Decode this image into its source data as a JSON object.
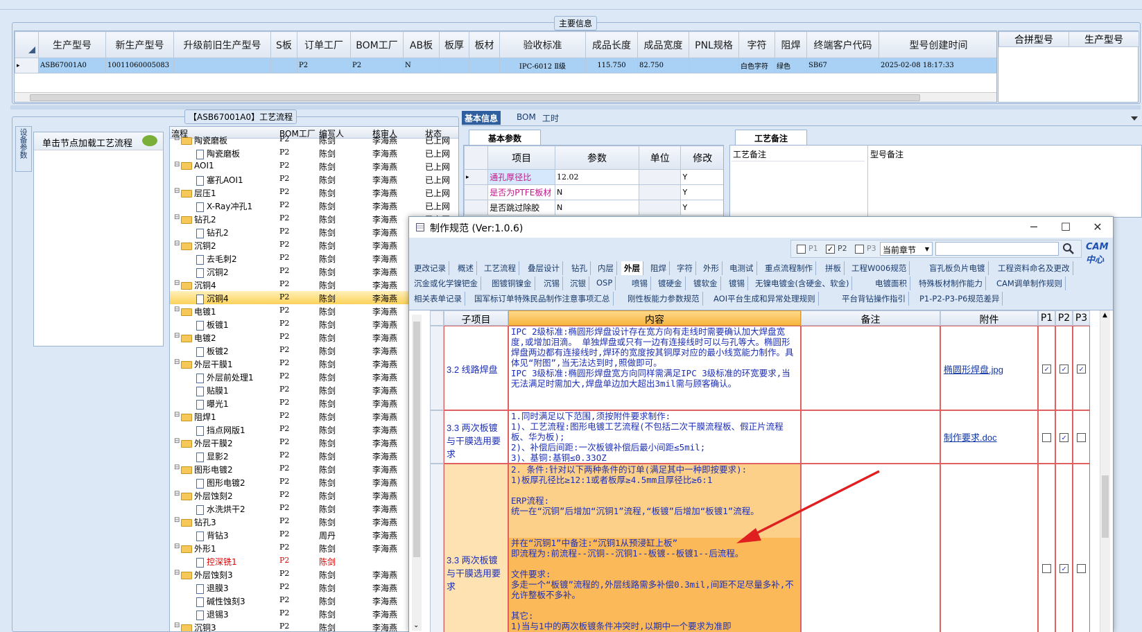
{
  "main_info": {
    "title": "主要信息",
    "columns": [
      "生产型号",
      "新生产型号",
      "升级前旧生产型号",
      "S板",
      "订单工厂",
      "BOM工厂",
      "AB板",
      "板厚",
      "板材",
      "验收标准",
      "成品长度",
      "成品宽度",
      "PNL规格",
      "字符",
      "阻焊",
      "终端客户代码",
      "型号创建时间"
    ],
    "row": [
      "ASB67001A0",
      "10011060005083",
      "",
      "",
      "P2",
      "P2",
      "N",
      "",
      "",
      "IPC-6012 Ⅱ级",
      "115.750",
      "82.750",
      "",
      "白色字符",
      "绿色",
      "SB67",
      "2025-02-08 18:17:33"
    ],
    "right_columns": [
      "合拼型号",
      "生产型号"
    ]
  },
  "process_panel": {
    "title": "【ASB67001A0】工艺流程",
    "side_tab": "流程",
    "side_tab2": "设备参数",
    "hint": "单击节点加载工艺流程",
    "columns": [
      "流程",
      "BOM工厂",
      "编写人",
      "核审人",
      "状态"
    ],
    "rows": [
      {
        "name": "陶瓷磨板",
        "type": "folder",
        "factory": "P2",
        "writer": "陈剑",
        "reviewer": "李海燕",
        "status": "已上网"
      },
      {
        "name": "陶瓷磨板",
        "type": "doc",
        "factory": "P2",
        "writer": "陈剑",
        "reviewer": "李海燕",
        "status": "已上网"
      },
      {
        "name": "AOI1",
        "type": "folder",
        "factory": "P2",
        "writer": "陈剑",
        "reviewer": "李海燕",
        "status": "已上网"
      },
      {
        "name": "塞孔AOI1",
        "type": "doc",
        "factory": "P2",
        "writer": "陈剑",
        "reviewer": "李海燕",
        "status": "已上网"
      },
      {
        "name": "层压1",
        "type": "folder",
        "factory": "P2",
        "writer": "陈剑",
        "reviewer": "李海燕",
        "status": "已上网"
      },
      {
        "name": "X-Ray冲孔1",
        "type": "doc",
        "factory": "P2",
        "writer": "陈剑",
        "reviewer": "李海燕",
        "status": "已上网"
      },
      {
        "name": "钻孔2",
        "type": "folder",
        "factory": "P2",
        "writer": "陈剑",
        "reviewer": "李海燕",
        "status": "已上网"
      },
      {
        "name": "钻孔2",
        "type": "doc",
        "factory": "P2",
        "writer": "陈剑",
        "reviewer": "李海燕",
        "status": ""
      },
      {
        "name": "沉铜2",
        "type": "folder",
        "factory": "P2",
        "writer": "陈剑",
        "reviewer": "李海燕",
        "status": ""
      },
      {
        "name": "去毛刺2",
        "type": "doc",
        "factory": "P2",
        "writer": "陈剑",
        "reviewer": "李海燕",
        "status": ""
      },
      {
        "name": "沉铜2",
        "type": "doc",
        "factory": "P2",
        "writer": "陈剑",
        "reviewer": "李海燕",
        "status": ""
      },
      {
        "name": "沉铜4",
        "type": "folder",
        "factory": "P2",
        "writer": "陈剑",
        "reviewer": "李海燕",
        "status": ""
      },
      {
        "name": "沉铜4",
        "type": "doc",
        "factory": "P2",
        "writer": "陈剑",
        "reviewer": "李海燕",
        "status": "",
        "selected": true
      },
      {
        "name": "电镀1",
        "type": "folder",
        "factory": "P2",
        "writer": "陈剑",
        "reviewer": "李海燕",
        "status": ""
      },
      {
        "name": "板镀1",
        "type": "doc",
        "factory": "P2",
        "writer": "陈剑",
        "reviewer": "李海燕",
        "status": ""
      },
      {
        "name": "电镀2",
        "type": "folder",
        "factory": "P2",
        "writer": "陈剑",
        "reviewer": "李海燕",
        "status": ""
      },
      {
        "name": "板镀2",
        "type": "doc",
        "factory": "P2",
        "writer": "陈剑",
        "reviewer": "李海燕",
        "status": ""
      },
      {
        "name": "外层干膜1",
        "type": "folder",
        "factory": "P2",
        "writer": "陈剑",
        "reviewer": "李海燕",
        "status": ""
      },
      {
        "name": "外层前处理1",
        "type": "doc",
        "factory": "P2",
        "writer": "陈剑",
        "reviewer": "李海燕",
        "status": ""
      },
      {
        "name": "贴膜1",
        "type": "doc",
        "factory": "P2",
        "writer": "陈剑",
        "reviewer": "李海燕",
        "status": ""
      },
      {
        "name": "曝光1",
        "type": "doc",
        "factory": "P2",
        "writer": "陈剑",
        "reviewer": "李海燕",
        "status": ""
      },
      {
        "name": "阻焊1",
        "type": "folder",
        "factory": "P2",
        "writer": "陈剑",
        "reviewer": "李海燕",
        "status": ""
      },
      {
        "name": "挡点网版1",
        "type": "doc",
        "factory": "P2",
        "writer": "陈剑",
        "reviewer": "李海燕",
        "status": ""
      },
      {
        "name": "外层干膜2",
        "type": "folder",
        "factory": "P2",
        "writer": "陈剑",
        "reviewer": "李海燕",
        "status": ""
      },
      {
        "name": "显影2",
        "type": "doc",
        "factory": "P2",
        "writer": "陈剑",
        "reviewer": "李海燕",
        "status": ""
      },
      {
        "name": "图形电镀2",
        "type": "folder",
        "factory": "P2",
        "writer": "陈剑",
        "reviewer": "李海燕",
        "status": ""
      },
      {
        "name": "图形电镀2",
        "type": "doc",
        "factory": "P2",
        "writer": "陈剑",
        "reviewer": "李海燕",
        "status": ""
      },
      {
        "name": "外层蚀刻2",
        "type": "folder",
        "factory": "P2",
        "writer": "陈剑",
        "reviewer": "李海燕",
        "status": ""
      },
      {
        "name": "水洗烘干2",
        "type": "doc",
        "factory": "P2",
        "writer": "陈剑",
        "reviewer": "李海燕",
        "status": ""
      },
      {
        "name": "钻孔3",
        "type": "folder",
        "factory": "P2",
        "writer": "陈剑",
        "reviewer": "李海燕",
        "status": ""
      },
      {
        "name": "背钻3",
        "type": "doc",
        "factory": "P2",
        "writer": "周丹",
        "reviewer": "李海燕",
        "status": ""
      },
      {
        "name": "外形1",
        "type": "folder",
        "factory": "P2",
        "writer": "陈剑",
        "reviewer": "李海燕",
        "status": ""
      },
      {
        "name": "控深铣1",
        "type": "doc",
        "factory": "P2",
        "writer": "陈剑",
        "reviewer": "",
        "status": "",
        "red": true
      },
      {
        "name": "外层蚀刻3",
        "type": "folder",
        "factory": "P2",
        "writer": "陈剑",
        "reviewer": "李海燕",
        "status": ""
      },
      {
        "name": "退膜3",
        "type": "doc",
        "factory": "P2",
        "writer": "陈剑",
        "reviewer": "李海燕",
        "status": ""
      },
      {
        "name": "碱性蚀刻3",
        "type": "doc",
        "factory": "P2",
        "writer": "陈剑",
        "reviewer": "李海燕",
        "status": ""
      },
      {
        "name": "退锡3",
        "type": "doc",
        "factory": "P2",
        "writer": "陈剑",
        "reviewer": "李海燕",
        "status": ""
      },
      {
        "name": "沉铜3",
        "type": "folder",
        "factory": "P2",
        "writer": "陈剑",
        "reviewer": "李海燕",
        "status": ""
      }
    ]
  },
  "basic_panel": {
    "tabs": [
      "基本信息",
      "BOM",
      "工时"
    ],
    "sub_tab": "基本参数",
    "columns": [
      "项目",
      "参数",
      "单位",
      "修改"
    ],
    "rows": [
      {
        "item": "通孔厚径比",
        "param": "12.02",
        "unit": "",
        "edit": "Y"
      },
      {
        "item": "是否为PTFE板材",
        "param": "N",
        "unit": "",
        "edit": "Y"
      },
      {
        "item": "是否跳过除胶",
        "param": "N",
        "unit": "",
        "edit": "Y"
      }
    ],
    "remarks_tab": "工艺备注",
    "remark_cols": [
      "工艺备注",
      "型号备注"
    ]
  },
  "dialog": {
    "title": "制作规范 (Ver:1.0.6)",
    "filters": {
      "p1": "P1",
      "p2": "P2",
      "p3": "P3",
      "scope": "当前章节",
      "cam": "CAM中心"
    },
    "tabs_row1": [
      "更改记录",
      "概述",
      "工艺流程",
      "叠层设计",
      "钻孔",
      "内层",
      "外层",
      "阻焊",
      "字符",
      "外形",
      "电测试",
      "重点流程制作",
      "拼板",
      "工程W006规范",
      "盲孔板负片电镀",
      "工程资料命名及更改"
    ],
    "tabs_row2": [
      "沉金或化学镍钯金",
      "图镀铜镍金",
      "沉锡",
      "沉银",
      "OSP",
      "喷锡",
      "镀硬金",
      "镀软金",
      "镀锡",
      "无镍电镀金(含硬金、软金)",
      "电镀面积",
      "特殊板材制作能力",
      "CAM调单制作规则"
    ],
    "tabs_row3": [
      "相关表单记录",
      "国军标订单特殊民品制作注意事项汇总",
      "刚性板能力参数规范",
      "AOI平台生成和异常处理规则",
      "平台背钻操作指引",
      "P1-P2-P3-P6规范差异"
    ],
    "columns": [
      "子项目",
      "内容",
      "备注",
      "附件",
      "P1",
      "P2",
      "P3"
    ],
    "rows": [
      {
        "sub": "3.2 线路焊盘",
        "content": "IPC 2级标准:椭圆形焊盘设计存在宽方向有走线时需要确认加大焊盘宽度,或增加泪滴。 单独焊盘或只有一边有连接线时可以与孔等大。椭圆形焊盘两边都有连接线时,焊环的宽度按其铜厚对应的最小线宽能力制作。具体见“附图”,当无法达到时,照做即可。\nIPC 3级标准:椭圆形焊盘宽方向同样需满足IPC 3级标准的环宽要求,当无法满足时需加大,焊盘单边加大超出3mil需与顾客确认。",
        "attach": "椭圆形焊盘.jpg",
        "p1": true,
        "p2": true,
        "p3": true
      },
      {
        "sub": "3.3 两次板镀与干膜选用要求",
        "content": "1.同时满足以下范围,须按附件要求制作:\n1)、工艺流程:图形电镀工艺流程(不包括二次干膜流程板、假正片流程板、华为板);\n2)、补偿后间距:一次板镀补偿后最小间距≤5mil;\n3)、基铜:基铜≤0.33OZ",
        "attach": "制作要求.doc",
        "p1": false,
        "p2": true,
        "p3": false
      },
      {
        "sub": "3.3 两次板镀与干膜选用要求",
        "content_a": "2. 条件:针对以下两种条件的订单(满足其中一种即按要求):\n1)板厚孔径比≥12:1或者板厚≥4.5mm且厚径比≥6:1\n\nERP流程:\n统一在“沉铜”后增加“沉铜1”流程,“板镀”后增加“板镀1”流程。",
        "content_b": "并在“沉铜1”中备注:“沉铜1从预浸缸上板”\n即流程为:前流程--沉铜--沉铜1--板镀--板镀1--后流程。\n\n文件要求:\n多走一个“板镀”流程的,外层线路需多补偿0.3mil,间距不足尽量多补,不允许整板不多补。\n\n其它:\n1)当与1中的两次板镀条件冲突时,以期中一个要求为准即",
        "attach": "",
        "p1": false,
        "p2": true,
        "p3": false
      }
    ]
  }
}
